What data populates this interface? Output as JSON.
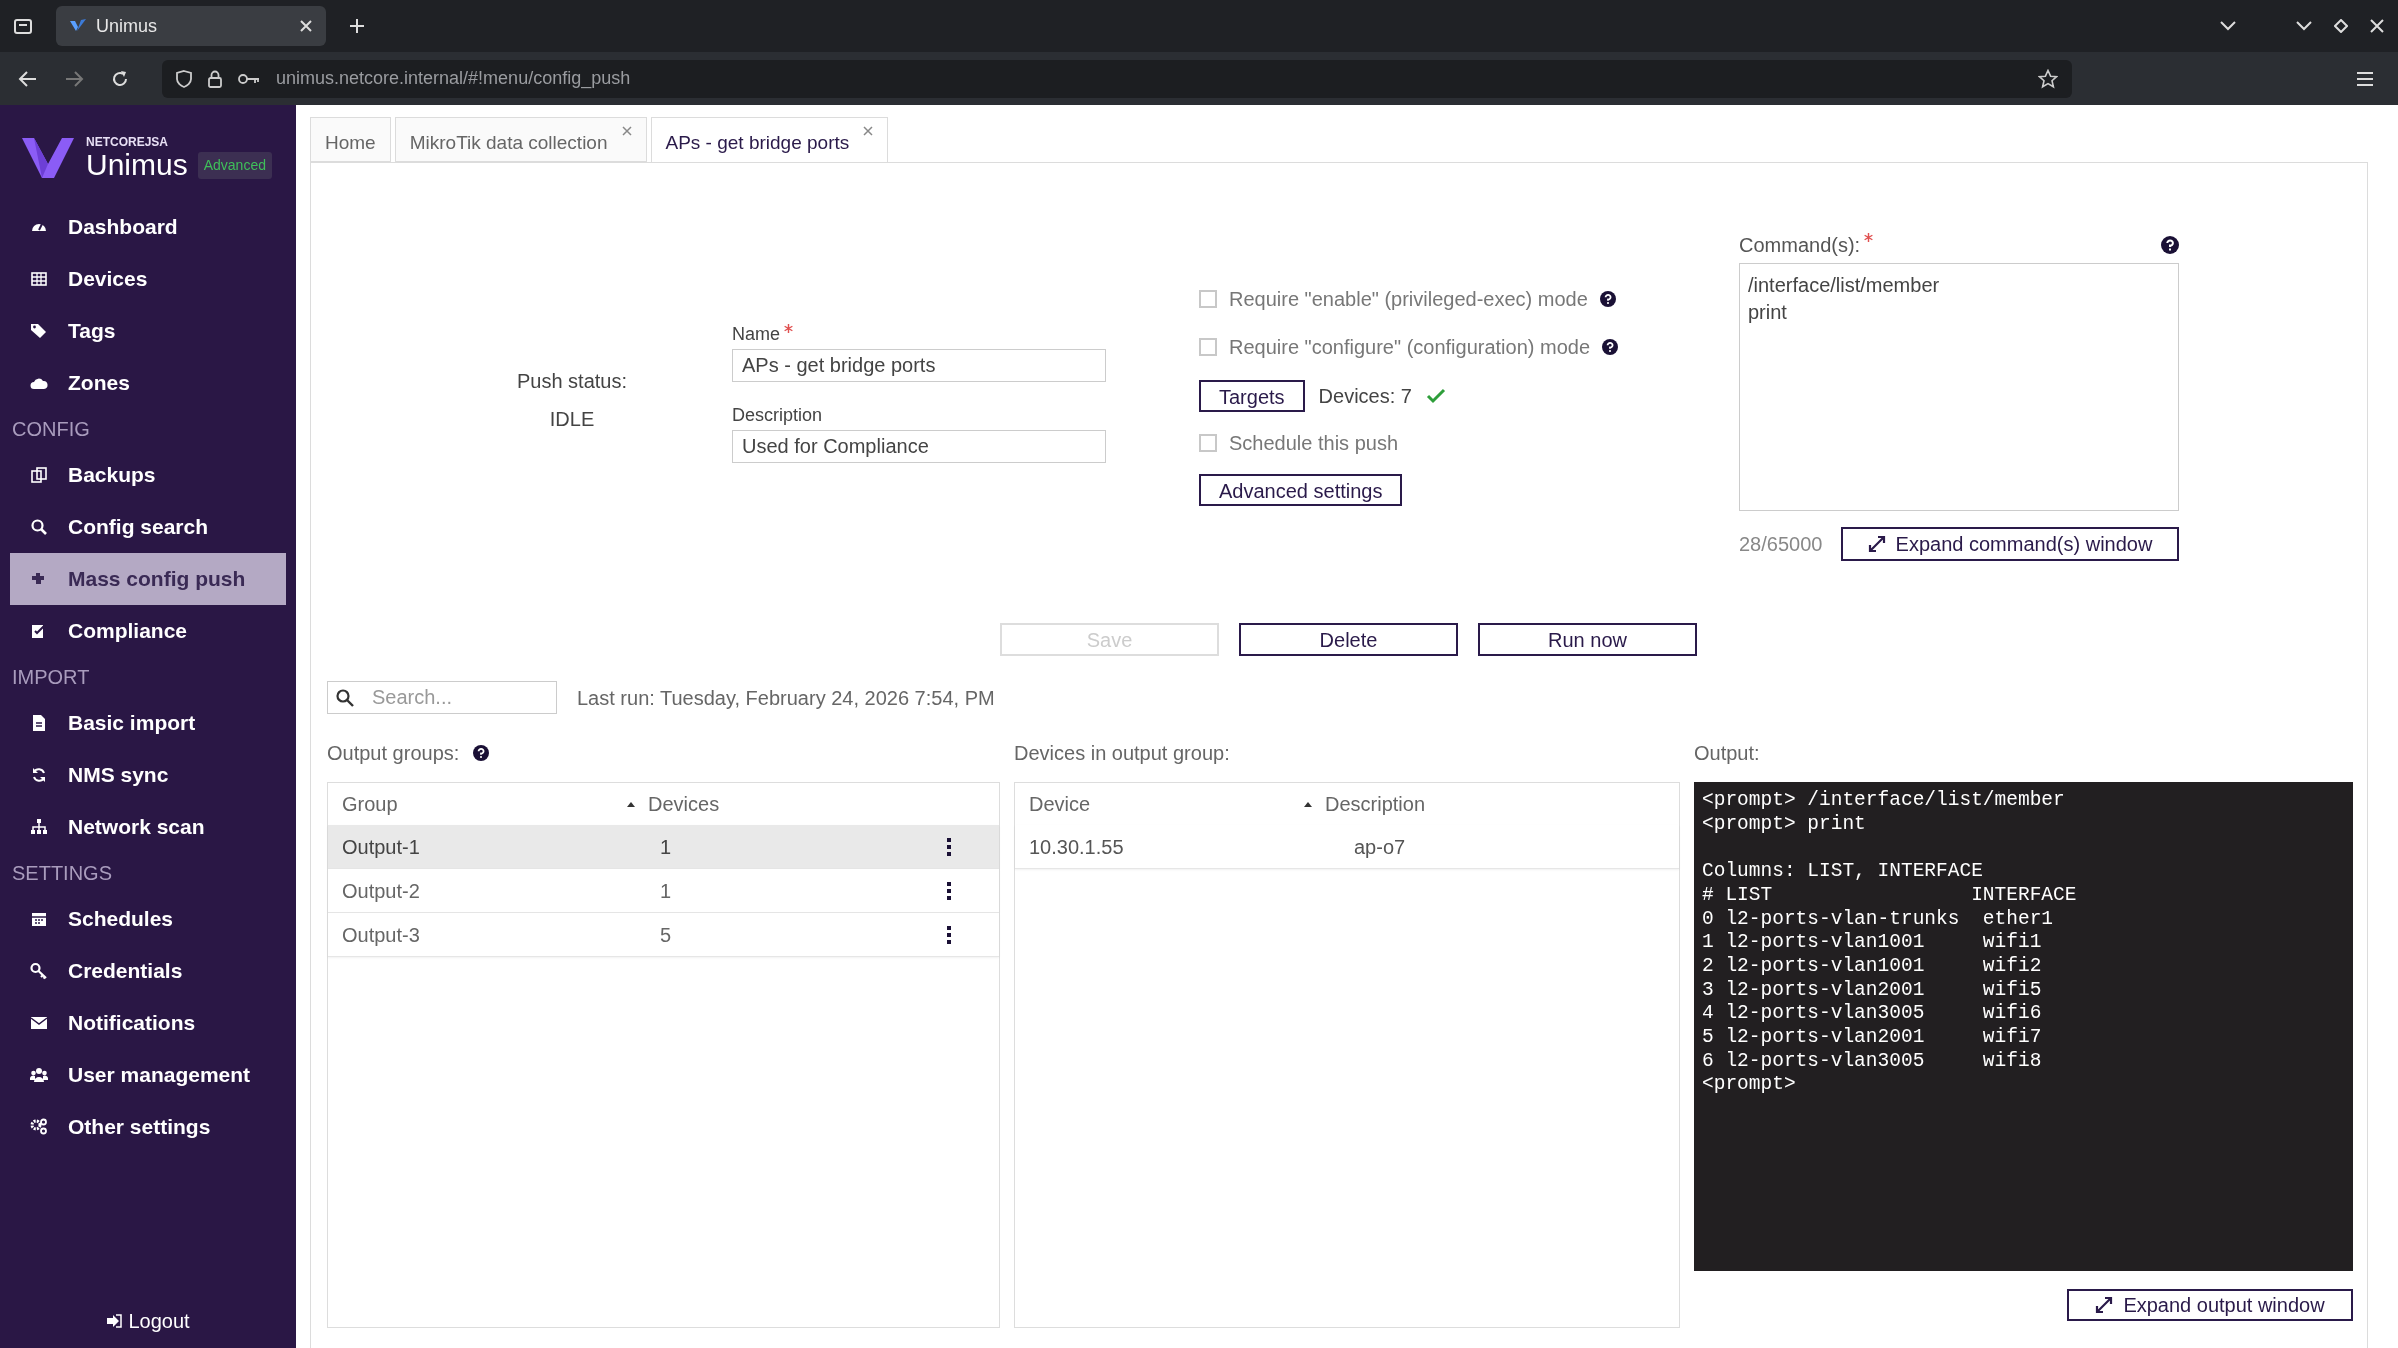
{
  "browser": {
    "tab_title": "Unimus",
    "url": "unimus.netcore.internal/#!menu/config_push"
  },
  "sidebar": {
    "brand_small": "NETCOREJSA",
    "brand_name": "Unimus",
    "edition": "Advanced",
    "items": [
      {
        "kind": "item",
        "label": "Dashboard",
        "selected": false
      },
      {
        "kind": "item",
        "label": "Devices",
        "selected": false
      },
      {
        "kind": "item",
        "label": "Tags",
        "selected": false
      },
      {
        "kind": "item",
        "label": "Zones",
        "selected": false
      },
      {
        "kind": "section",
        "label": "CONFIG"
      },
      {
        "kind": "item",
        "label": "Backups",
        "selected": false
      },
      {
        "kind": "item",
        "label": "Config search",
        "selected": false
      },
      {
        "kind": "item",
        "label": "Mass config push",
        "selected": true
      },
      {
        "kind": "item",
        "label": "Compliance",
        "selected": false
      },
      {
        "kind": "section",
        "label": "IMPORT"
      },
      {
        "kind": "item",
        "label": "Basic import",
        "selected": false
      },
      {
        "kind": "item",
        "label": "NMS sync",
        "selected": false
      },
      {
        "kind": "item",
        "label": "Network scan",
        "selected": false
      },
      {
        "kind": "section",
        "label": "SETTINGS"
      },
      {
        "kind": "item",
        "label": "Schedules",
        "selected": false
      },
      {
        "kind": "item",
        "label": "Credentials",
        "selected": false
      },
      {
        "kind": "item",
        "label": "Notifications",
        "selected": false
      },
      {
        "kind": "item",
        "label": "User management",
        "selected": false
      },
      {
        "kind": "item",
        "label": "Other settings",
        "selected": false
      }
    ],
    "logout": "Logout"
  },
  "tabs": [
    {
      "label": "Home",
      "selected": false,
      "closable": false
    },
    {
      "label": "MikroTik data collection",
      "selected": false,
      "closable": true
    },
    {
      "label": "APs - get bridge ports",
      "selected": true,
      "closable": true
    }
  ],
  "push_status": {
    "label": "Push status:",
    "value": "IDLE"
  },
  "name_field": {
    "label": "Name",
    "required": true,
    "value": "APs - get bridge ports"
  },
  "description_field": {
    "label": "Description",
    "required": false,
    "value": "Used for Compliance"
  },
  "mode_options": [
    {
      "label": "Require \"enable\" (privileged-exec) mode",
      "checked": false,
      "help": true
    },
    {
      "label": "Require \"configure\" (configuration) mode",
      "checked": false,
      "help": true
    }
  ],
  "targets": {
    "button": "Targets",
    "devices": "Devices: 7",
    "valid": true
  },
  "schedule": {
    "label": "Schedule this push",
    "checked": false
  },
  "advanced_button": "Advanced settings",
  "commands": {
    "label": "Command(s):",
    "required": true,
    "value": "/interface/list/member\nprint",
    "counter": "28/65000",
    "expand_button": "Expand command(s) window"
  },
  "actions": [
    {
      "label": "Save",
      "disabled": true
    },
    {
      "label": "Delete",
      "disabled": false
    },
    {
      "label": "Run now",
      "disabled": false
    }
  ],
  "search": {
    "placeholder": "Search..."
  },
  "last_run": "Last run: Tuesday, February 24, 2026 7:54, PM",
  "output_groups": {
    "label": "Output groups:",
    "help": true,
    "columns": [
      {
        "label": "Group",
        "sorted": true
      },
      {
        "label": "Devices",
        "sorted": false
      }
    ],
    "rows": [
      {
        "group": "Output-1",
        "devices": "1",
        "selected": true
      },
      {
        "group": "Output-2",
        "devices": "1",
        "selected": false
      },
      {
        "group": "Output-3",
        "devices": "5",
        "selected": false
      }
    ]
  },
  "devices_in_group": {
    "label": "Devices in output group:",
    "columns": [
      {
        "label": "Device",
        "sorted": true
      },
      {
        "label": "Description",
        "sorted": false
      }
    ],
    "rows": [
      {
        "device": "10.30.1.55",
        "description": "ap-o7"
      }
    ]
  },
  "output": {
    "label": "Output:",
    "text": "<prompt> /interface/list/member\n<prompt> print\n\nColumns: LIST, INTERFACE\n# LIST                 INTERFACE\n0 l2-ports-vlan-trunks  ether1\n1 l2-ports-vlan1001     wifi1\n2 l2-ports-vlan1001     wifi2\n3 l2-ports-vlan2001     wifi5\n4 l2-ports-vlan3005     wifi6\n5 l2-ports-vlan2001     wifi7\n6 l2-ports-vlan3005     wifi8\n<prompt>",
    "expand_button": "Expand output window"
  }
}
